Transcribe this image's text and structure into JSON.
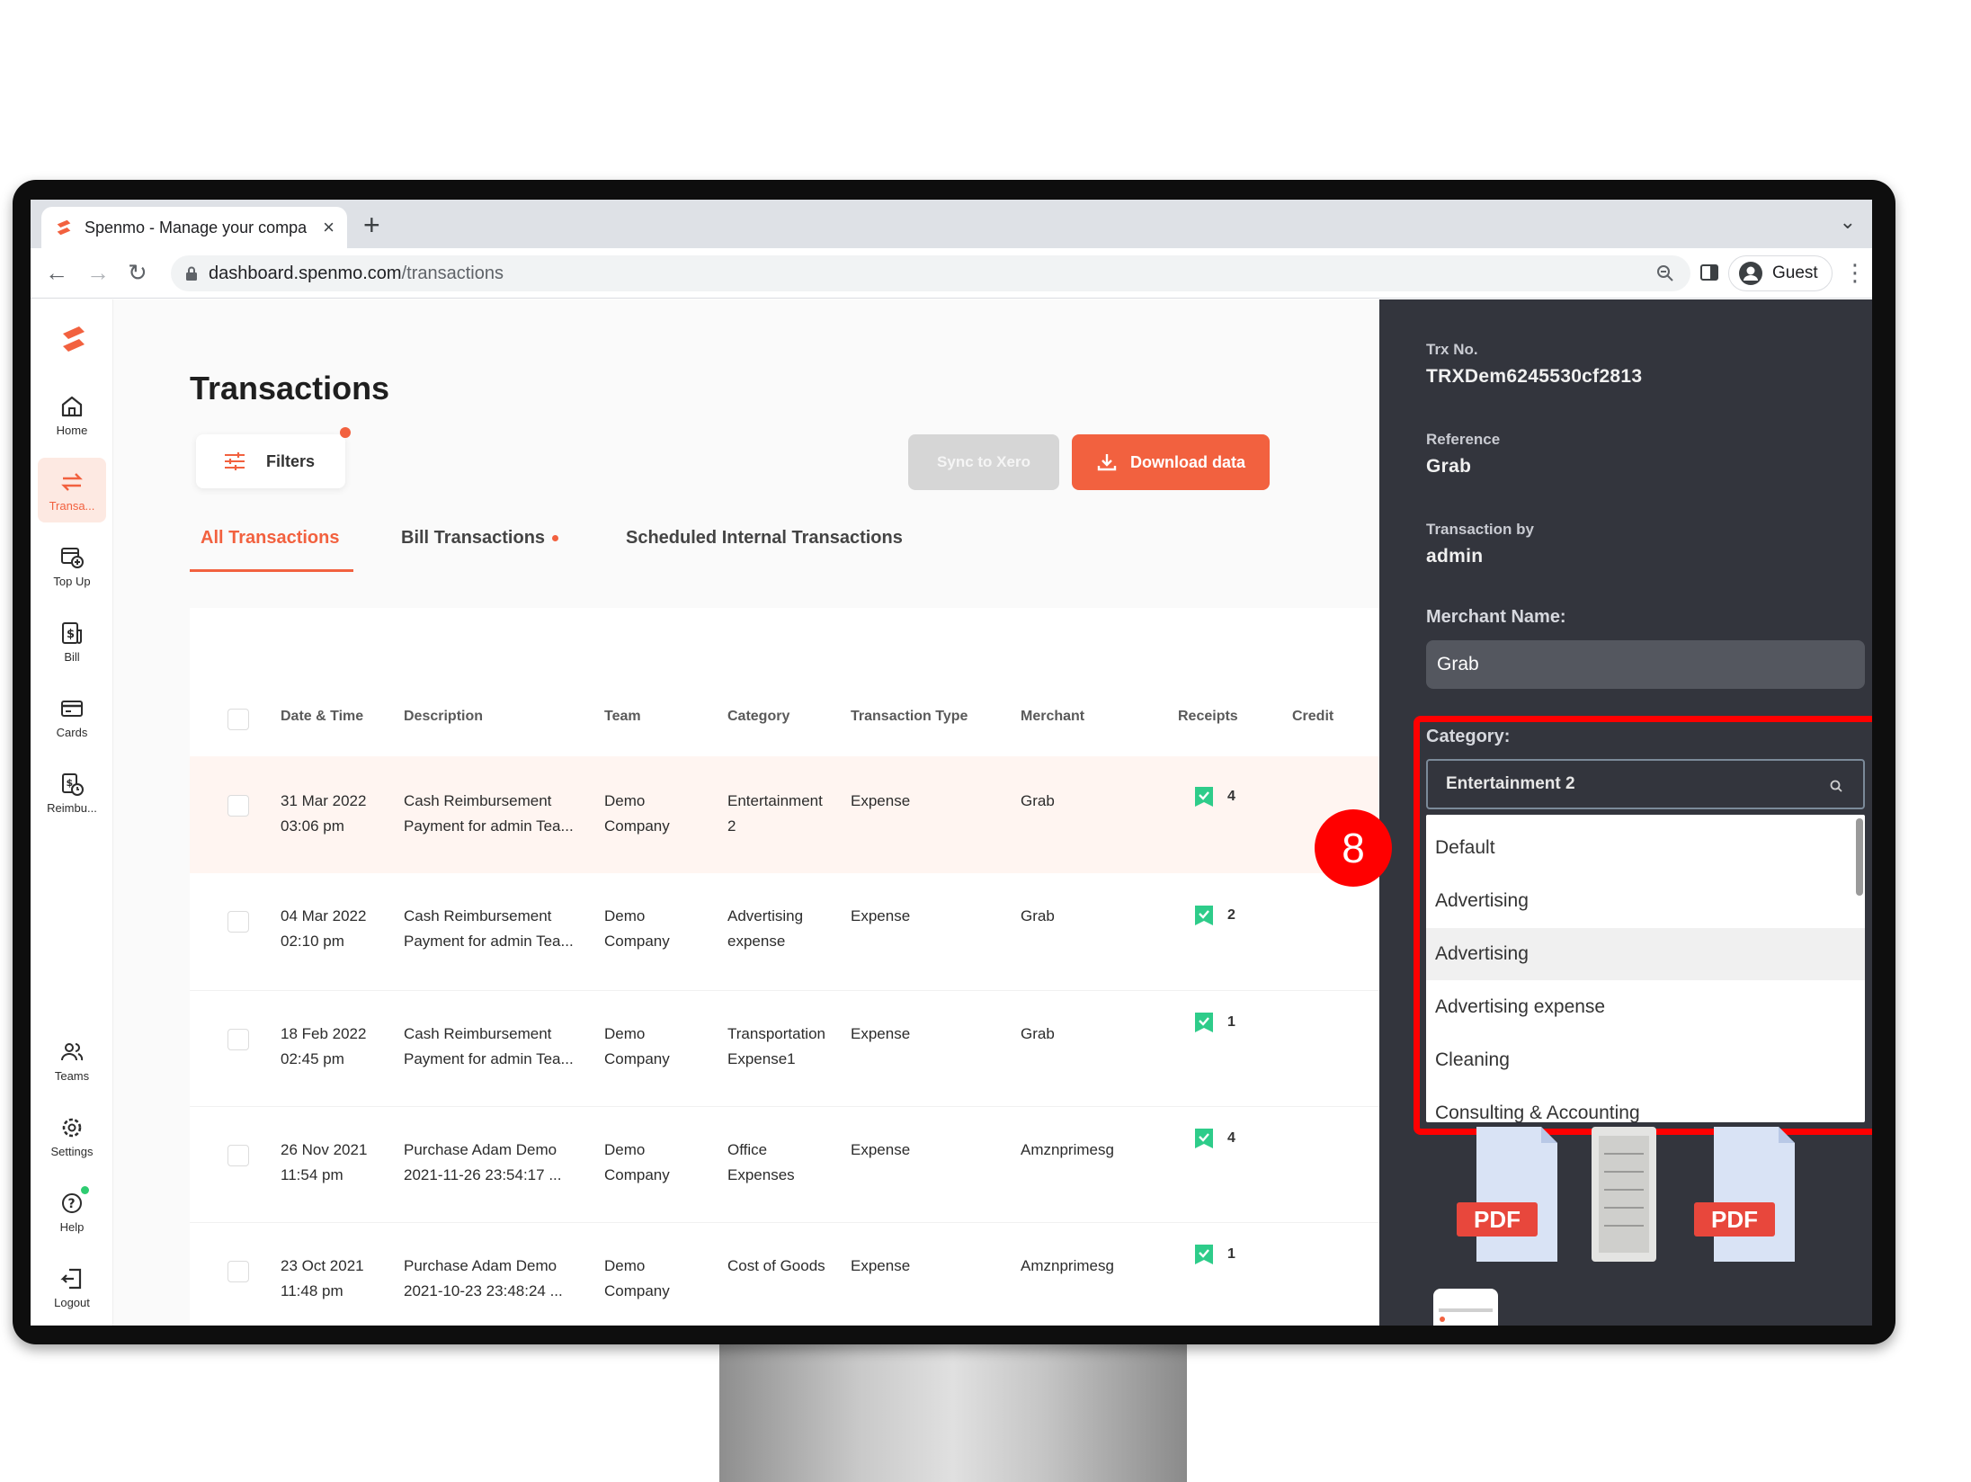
{
  "browser": {
    "tab_title": "Spenmo - Manage your compa",
    "tab_close": "×",
    "new_tab": "+",
    "url_domain": "dashboard.spenmo.com",
    "url_path": "/transactions",
    "profile_label": "Guest"
  },
  "sidebar": {
    "items": [
      {
        "label": "Home",
        "icon": "home-icon"
      },
      {
        "label": "Transa...",
        "icon": "transfer-icon"
      },
      {
        "label": "Top Up",
        "icon": "top-up-icon"
      },
      {
        "label": "Bill",
        "icon": "bill-icon"
      },
      {
        "label": "Cards",
        "icon": "card-icon"
      },
      {
        "label": "Reimbu...",
        "icon": "reimbursement-icon"
      },
      {
        "label": "Teams",
        "icon": "teams-icon"
      },
      {
        "label": "Settings",
        "icon": "gear-icon"
      },
      {
        "label": "Help",
        "icon": "help-icon"
      },
      {
        "label": "Logout",
        "icon": "logout-icon"
      }
    ]
  },
  "main": {
    "title": "Transactions",
    "filters_label": "Filters",
    "sync_label": "Sync to Xero",
    "download_label": "Download data",
    "tabs": [
      {
        "label": "All Transactions"
      },
      {
        "label": "Bill Transactions"
      },
      {
        "label": "Scheduled Internal Transactions"
      }
    ],
    "columns": [
      "Date & Time",
      "Description",
      "Team",
      "Category",
      "Transaction Type",
      "Merchant",
      "Receipts",
      "Credit"
    ],
    "rows": [
      {
        "date": "31 Mar 2022",
        "time": "03:06 pm",
        "desc1": "Cash Reimbursement",
        "desc2": "Payment for admin Tea...",
        "team1": "Demo",
        "team2": "Company",
        "cat1": "Entertainment",
        "cat2": "2",
        "type": "Expense",
        "merchant": "Grab",
        "receipts": "4"
      },
      {
        "date": "04 Mar 2022",
        "time": "02:10 pm",
        "desc1": "Cash Reimbursement",
        "desc2": "Payment for admin Tea...",
        "team1": "Demo",
        "team2": "Company",
        "cat1": "Advertising",
        "cat2": "expense",
        "type": "Expense",
        "merchant": "Grab",
        "receipts": "2"
      },
      {
        "date": "18 Feb 2022",
        "time": "02:45 pm",
        "desc1": "Cash Reimbursement",
        "desc2": "Payment for admin Tea...",
        "team1": "Demo",
        "team2": "Company",
        "cat1": "Transportation",
        "cat2": "Expense1",
        "type": "Expense",
        "merchant": "Grab",
        "receipts": "1"
      },
      {
        "date": "26 Nov 2021",
        "time": "11:54 pm",
        "desc1": "Purchase Adam Demo",
        "desc2": "2021-11-26 23:54:17 ...",
        "team1": "Demo",
        "team2": "Company",
        "cat1": "Office",
        "cat2": "Expenses",
        "type": "Expense",
        "merchant": "Amznprimesg",
        "receipts": "4"
      },
      {
        "date": "23 Oct 2021",
        "time": "11:48 pm",
        "desc1": "Purchase Adam Demo",
        "desc2": "2021-10-23 23:48:24 ...",
        "team1": "Demo",
        "team2": "Company",
        "cat1": "Cost of Goods",
        "cat2": "",
        "type": "Expense",
        "merchant": "Amznprimesg",
        "receipts": "1"
      }
    ]
  },
  "panel": {
    "trx_label": "Trx No.",
    "trx_value": "TRXDem6245530cf2813",
    "ref_label": "Reference",
    "ref_value": "Grab",
    "by_label": "Transaction by",
    "by_value": "admin",
    "merchant_label": "Merchant Name:",
    "merchant_value": "Grab",
    "category_label": "Category:",
    "category_value": "Entertainment 2",
    "options": [
      "Default",
      "Advertising",
      "Advertising",
      "Advertising expense",
      "Cleaning",
      "Consulting & Accounting"
    ],
    "file_label": "PDF"
  },
  "annotation": {
    "step": "8"
  },
  "colors": {
    "accent": "#f2613f",
    "panel_bg": "#33353d",
    "highlight": "#ff0000",
    "receipt_green": "#2ecc8a"
  }
}
